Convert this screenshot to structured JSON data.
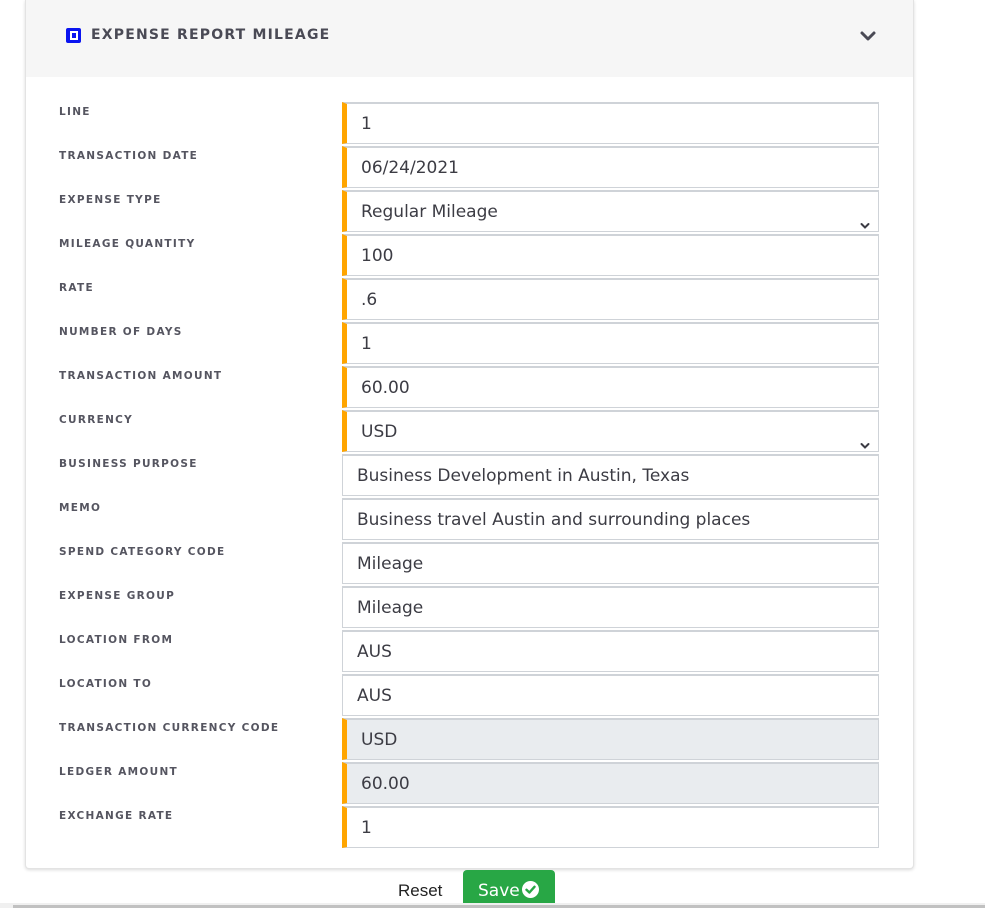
{
  "header": {
    "title": "EXPENSE REPORT MILEAGE",
    "icon": "wallet-icon",
    "collapse_icon": "chevron-down-icon",
    "accent_color": "#0a14f0"
  },
  "form": {
    "required_color": "#ffa500",
    "fields": [
      {
        "label": "LINE",
        "value": "1",
        "type": "text",
        "required": true,
        "readonly": false
      },
      {
        "label": "TRANSACTION DATE",
        "value": "06/24/2021",
        "type": "text",
        "required": true,
        "readonly": false
      },
      {
        "label": "EXPENSE TYPE",
        "value": "Regular Mileage",
        "type": "select",
        "required": true,
        "readonly": false
      },
      {
        "label": "MILEAGE QUANTITY",
        "value": "100",
        "type": "text",
        "required": true,
        "readonly": false
      },
      {
        "label": "RATE",
        "value": ".6",
        "type": "text",
        "required": true,
        "readonly": false
      },
      {
        "label": "NUMBER OF DAYS",
        "value": "1",
        "type": "text",
        "required": true,
        "readonly": false
      },
      {
        "label": "TRANSACTION AMOUNT",
        "value": "60.00",
        "type": "text",
        "required": true,
        "readonly": false
      },
      {
        "label": "CURRENCY",
        "value": "USD",
        "type": "select",
        "required": true,
        "readonly": false
      },
      {
        "label": "BUSINESS PURPOSE",
        "value": "Business Development in Austin, Texas",
        "type": "text",
        "required": false,
        "readonly": false
      },
      {
        "label": "MEMO",
        "value": "Business travel Austin and surrounding places",
        "type": "text",
        "required": false,
        "readonly": false
      },
      {
        "label": "SPEND CATEGORY CODE",
        "value": "Mileage",
        "type": "text",
        "required": false,
        "readonly": false
      },
      {
        "label": "EXPENSE GROUP",
        "value": "Mileage",
        "type": "text",
        "required": false,
        "readonly": false
      },
      {
        "label": "LOCATION FROM",
        "value": "AUS",
        "type": "text",
        "required": false,
        "readonly": false
      },
      {
        "label": "LOCATION TO",
        "value": "AUS",
        "type": "text",
        "required": false,
        "readonly": false
      },
      {
        "label": "TRANSACTION CURRENCY CODE",
        "value": "USD",
        "type": "text",
        "required": true,
        "readonly": true
      },
      {
        "label": "LEDGER AMOUNT",
        "value": "60.00",
        "type": "text",
        "required": true,
        "readonly": true
      },
      {
        "label": "EXCHANGE RATE",
        "value": "1",
        "type": "text",
        "required": true,
        "readonly": false
      }
    ]
  },
  "actions": {
    "reset_label": "Reset",
    "save_label": "Save",
    "save_icon": "check-circle-icon",
    "save_color": "#28a745"
  }
}
